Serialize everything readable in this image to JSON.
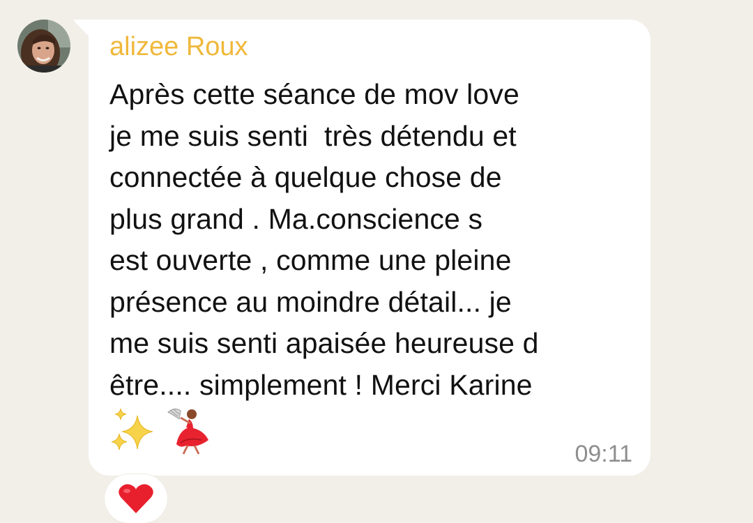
{
  "message": {
    "sender_name": "alizee Roux",
    "sender_color": "#f0b83a",
    "lines": [
      "Après cette séance de mov love",
      "je me suis senti  très détendu et",
      "connectée à quelque chose de",
      "plus grand . Ma.conscience s",
      "est ouverte , comme une pleine",
      "présence au moindre détail... je",
      "me suis senti apaisée heureuse d",
      "être.... simplement ! Merci Karine"
    ],
    "emojis": [
      "sparkles-icon",
      "dancer-icon"
    ],
    "time": "09:11"
  },
  "reaction": {
    "icon": "red-heart-icon",
    "color": "#e8202e"
  },
  "colors": {
    "background": "#f2efe9",
    "bubble": "#ffffff",
    "text": "#111111",
    "timestamp": "#8e8e8e"
  }
}
